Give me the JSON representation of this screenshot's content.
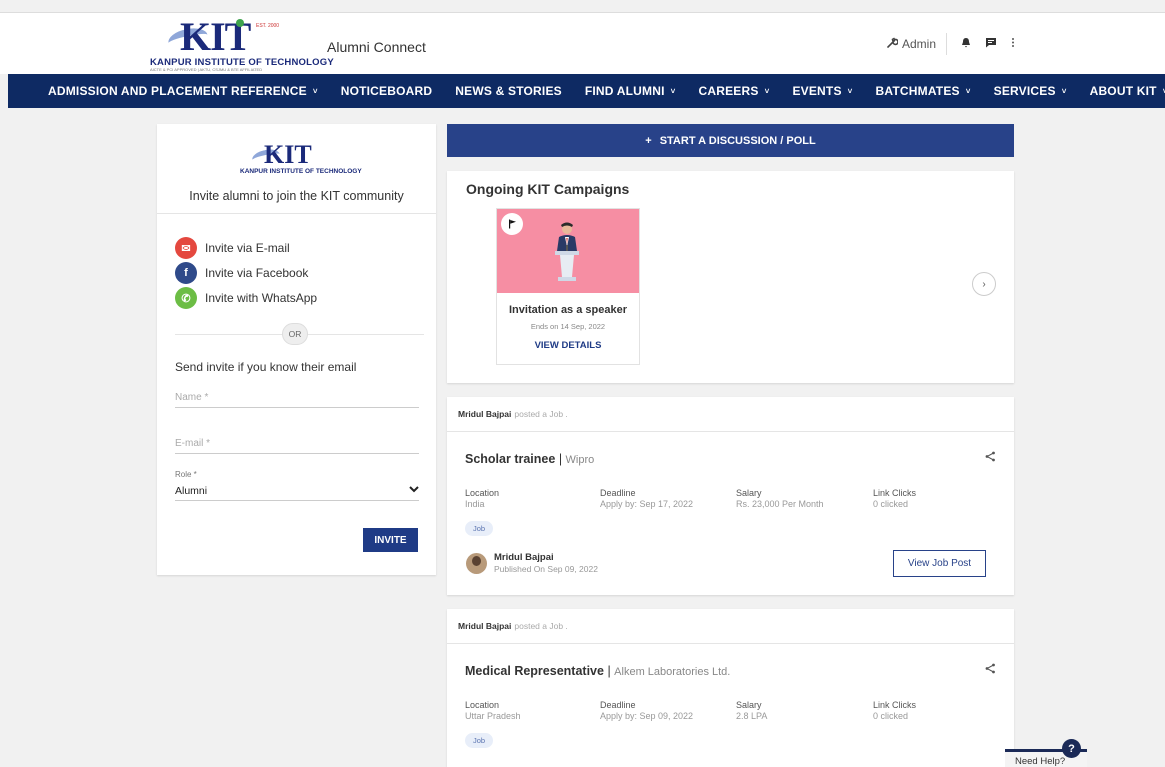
{
  "header": {
    "logo": {
      "name": "KIT",
      "subtitle": "KANPUR INSTITUTE OF TECHNOLOGY",
      "tagline": "AICTE & PCI APPROVED | AKTU, CSJMU & BTE AFFILIATED",
      "est": "EST. 2000"
    },
    "app_title": "Alumni Connect",
    "admin_label": "Admin"
  },
  "nav": {
    "items": [
      {
        "label": "ADMISSION AND PLACEMENT REFERENCE",
        "dropdown": true
      },
      {
        "label": "NOTICEBOARD",
        "dropdown": false
      },
      {
        "label": "NEWS & STORIES",
        "dropdown": false
      },
      {
        "label": "FIND ALUMNI",
        "dropdown": true
      },
      {
        "label": "CAREERS",
        "dropdown": true
      },
      {
        "label": "EVENTS",
        "dropdown": true
      },
      {
        "label": "BATCHMATES",
        "dropdown": true
      },
      {
        "label": "SERVICES",
        "dropdown": true
      },
      {
        "label": "ABOUT KIT",
        "dropdown": true
      }
    ],
    "chevron": "˅"
  },
  "invite": {
    "title": "Invite alumni to join the KIT community",
    "options": [
      {
        "label": "Invite via E-mail",
        "color": "#e4483f",
        "glyph": "✉"
      },
      {
        "label": "Invite via Facebook",
        "color": "#2f4a8a",
        "glyph": "f"
      },
      {
        "label": "Invite with WhatsApp",
        "color": "#6cbd45",
        "glyph": "✆"
      }
    ],
    "or_label": "OR",
    "send_label": "Send invite if you know their email",
    "name_placeholder": "Name *",
    "email_placeholder": "E-mail *",
    "role_label": "Role *",
    "role_value": "Alumni",
    "invite_button": "INVITE"
  },
  "discussion_button": "START A DISCUSSION / POLL",
  "campaigns": {
    "title": "Ongoing KIT Campaigns",
    "items": [
      {
        "name": "Invitation as a speaker",
        "ends": "Ends on 14 Sep, 2022",
        "link": "VIEW DETAILS"
      }
    ]
  },
  "jobs": [
    {
      "poster": "Mridul Bajpai",
      "action": "posted a Job .",
      "role": "Scholar trainee",
      "company": "Wipro",
      "meta": [
        {
          "key": "Location",
          "value": "India"
        },
        {
          "key": "Deadline",
          "value": "Apply by: Sep 17, 2022"
        },
        {
          "key": "Salary",
          "value": "Rs. 23,000 Per Month"
        },
        {
          "key": "Link Clicks",
          "value": "0 clicked"
        }
      ],
      "tag": "Job",
      "author": "Mridul Bajpai",
      "published": "Published On Sep 09, 2022",
      "view_button": "View Job Post"
    },
    {
      "poster": "Mridul Bajpai",
      "action": "posted a Job .",
      "role": "Medical Representative",
      "company": "Alkem Laboratories Ltd.",
      "meta": [
        {
          "key": "Location",
          "value": "Uttar Pradesh"
        },
        {
          "key": "Deadline",
          "value": "Apply by: Sep 09, 2022"
        },
        {
          "key": "Salary",
          "value": "2.8 LPA"
        },
        {
          "key": "Link Clicks",
          "value": "0 clicked"
        }
      ],
      "tag": "Job"
    }
  ],
  "help": {
    "label": "Need Help?",
    "glyph": "?"
  },
  "colors": {
    "nav": "#0e2a63",
    "primary": "#284289",
    "campaign_bg": "#f68ea3"
  }
}
